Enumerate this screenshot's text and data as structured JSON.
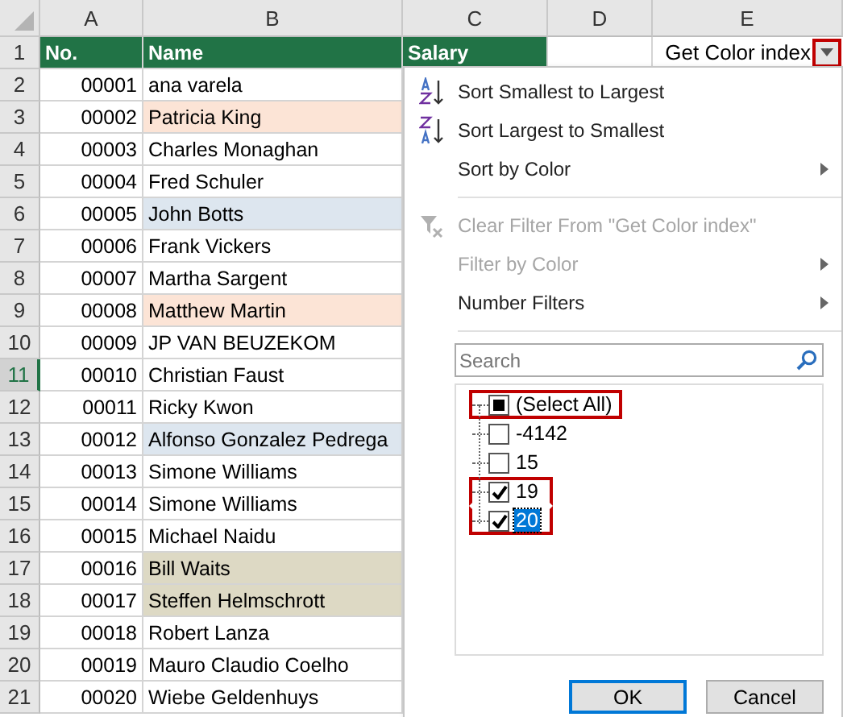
{
  "columns": [
    "A",
    "B",
    "C",
    "D",
    "E"
  ],
  "header_row": {
    "number": "1",
    "cells": [
      "No.",
      "Name",
      "Salary",
      "",
      "Get Color index"
    ],
    "filter_button": {
      "highlighted": true
    }
  },
  "rows": [
    {
      "number": "2",
      "no": "00001",
      "name": "ana varela",
      "color": "#ffffff",
      "selected": false
    },
    {
      "number": "3",
      "no": "00002",
      "name": "Patricia King",
      "color": "#fce4d6",
      "selected": false
    },
    {
      "number": "4",
      "no": "00003",
      "name": "Charles Monaghan",
      "color": "#ffffff",
      "selected": false
    },
    {
      "number": "5",
      "no": "00004",
      "name": "Fred Schuler",
      "color": "#ffffff",
      "selected": false
    },
    {
      "number": "6",
      "no": "00005",
      "name": "John Botts",
      "color": "#dde6ef",
      "selected": false
    },
    {
      "number": "7",
      "no": "00006",
      "name": "Frank Vickers",
      "color": "#ffffff",
      "selected": false
    },
    {
      "number": "8",
      "no": "00007",
      "name": "Martha Sargent",
      "color": "#ffffff",
      "selected": false
    },
    {
      "number": "9",
      "no": "00008",
      "name": "Matthew Martin",
      "color": "#fce4d6",
      "selected": false
    },
    {
      "number": "10",
      "no": "00009",
      "name": "JP VAN BEUZEKOM",
      "color": "#ffffff",
      "selected": false
    },
    {
      "number": "11",
      "no": "00010",
      "name": "Christian Faust",
      "color": "#ffffff",
      "selected": true
    },
    {
      "number": "12",
      "no": "00011",
      "name": "Ricky Kwon",
      "color": "#ffffff",
      "selected": false
    },
    {
      "number": "13",
      "no": "00012",
      "name": "Alfonso Gonzalez Pedrega",
      "color": "#dde6ef",
      "selected": false
    },
    {
      "number": "14",
      "no": "00013",
      "name": "Simone Williams",
      "color": "#ffffff",
      "selected": false
    },
    {
      "number": "15",
      "no": "00014",
      "name": "Simone Williams",
      "color": "#ffffff",
      "selected": false
    },
    {
      "number": "16",
      "no": "00015",
      "name": "Michael Naidu",
      "color": "#ffffff",
      "selected": false
    },
    {
      "number": "17",
      "no": "00016",
      "name": "Bill Waits",
      "color": "#ddd9c4",
      "selected": false
    },
    {
      "number": "18",
      "no": "00017",
      "name": "Steffen Helmschrott",
      "color": "#ddd9c4",
      "selected": false
    },
    {
      "number": "19",
      "no": "00018",
      "name": "Robert Lanza",
      "color": "#ffffff",
      "selected": false
    },
    {
      "number": "20",
      "no": "00019",
      "name": "Mauro Claudio Coelho",
      "color": "#ffffff",
      "selected": false
    },
    {
      "number": "21",
      "no": "00020",
      "name": "Wiebe Geldenhuys",
      "color": "#ffffff",
      "selected": false
    }
  ],
  "filter_menu": {
    "items": [
      {
        "kind": "sort-ascending",
        "label": "Sort Smallest to Largest",
        "disabled": false,
        "submenu": false
      },
      {
        "kind": "sort-descending",
        "label": "Sort Largest to Smallest",
        "disabled": false,
        "submenu": false
      },
      {
        "kind": "plain",
        "label": "Sort by Color",
        "disabled": false,
        "submenu": true
      },
      {
        "kind": "separator"
      },
      {
        "kind": "clear-filter",
        "label": "Clear Filter From \"Get Color index\"",
        "disabled": true,
        "submenu": false
      },
      {
        "kind": "plain",
        "label": "Filter by Color",
        "disabled": true,
        "submenu": true
      },
      {
        "kind": "plain",
        "label": "Number Filters",
        "disabled": false,
        "submenu": true
      },
      {
        "kind": "separator"
      }
    ],
    "search": {
      "placeholder": "Search"
    },
    "values": [
      {
        "label": "(Select All)",
        "checked": false,
        "partial": true,
        "selected": false,
        "highlighted": true
      },
      {
        "label": "-4142",
        "checked": false,
        "selected": false,
        "highlighted": false
      },
      {
        "label": "15",
        "checked": false,
        "selected": false,
        "highlighted": false
      },
      {
        "label": "19",
        "checked": true,
        "selected": false,
        "highlighted": true
      },
      {
        "label": "20",
        "checked": true,
        "selected": true,
        "highlighted": true
      }
    ],
    "buttons": [
      {
        "label": "OK",
        "default": true
      },
      {
        "label": "Cancel",
        "default": false
      }
    ]
  }
}
